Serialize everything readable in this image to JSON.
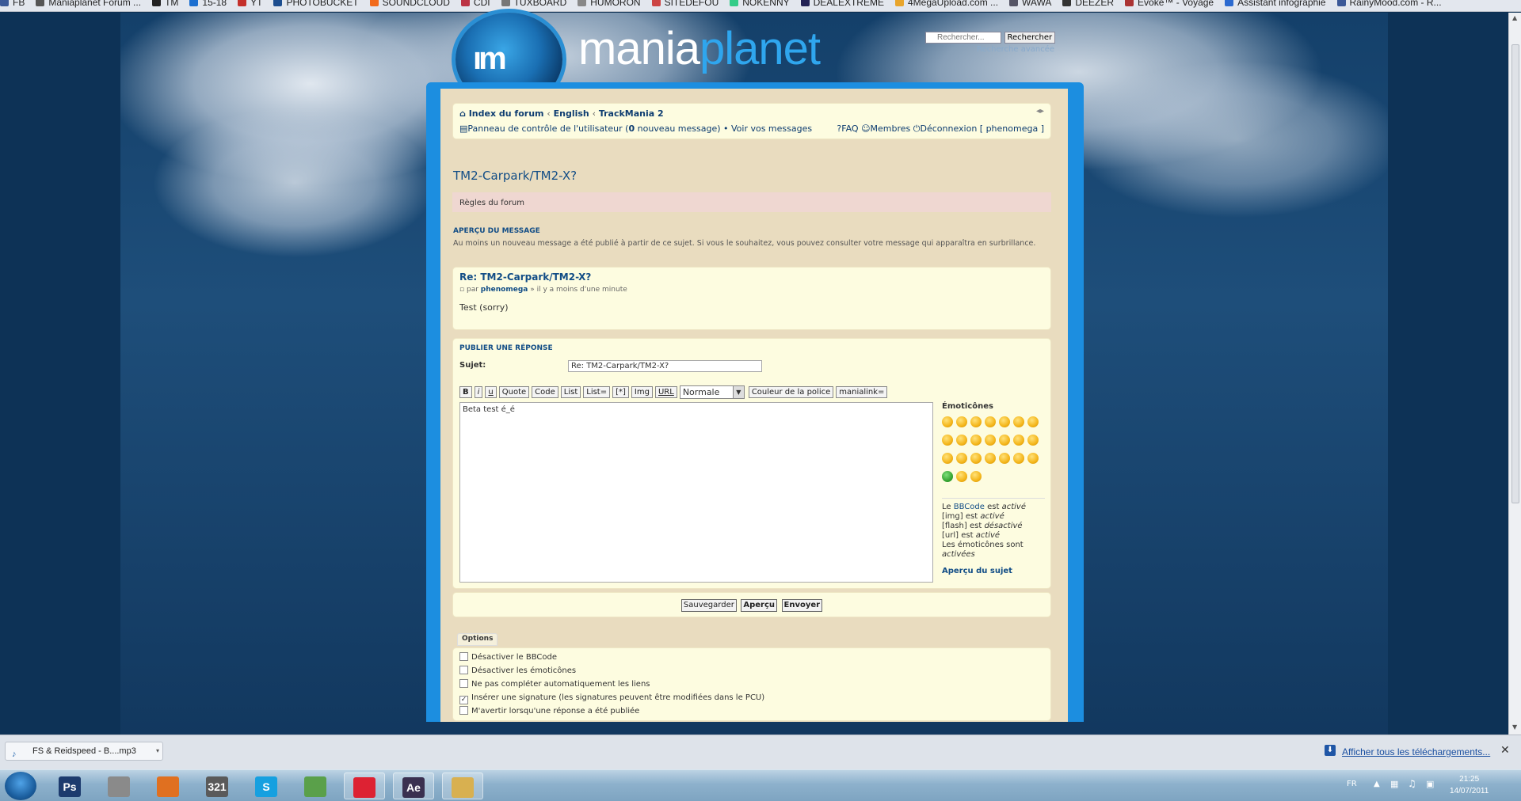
{
  "bookmarks": [
    "FB",
    "Maniaplanet Forum ...",
    "TM",
    "15-18",
    "YT",
    "PHOTOBUCKET",
    "SOUNDCLOUD",
    "CDI",
    "TUXBOARD",
    "HUMORON",
    "SITEDEFOU",
    "NOKENNY",
    "DEALEXTREME",
    "4MegaUpload.com ...",
    "WAWA",
    "DEEZER",
    "Evoke™ - Voyage",
    "Assistant infographie",
    "RainyMood.com - R..."
  ],
  "header": {
    "brand_a": "mania",
    "brand_b": "planet",
    "logo_glyph": "ım",
    "search_placeholder": "Rechercher...",
    "search_btn": "Rechercher",
    "advanced": "Recherche avancée"
  },
  "nav": {
    "crumb": [
      "Index du forum",
      "English",
      "TrackMania 2"
    ],
    "sep": "‹",
    "ucp_a": "Panneau de contrôle de l'utilisateur (",
    "ucp_count": "0",
    "ucp_b": " nouveau message) • Voir vos messages",
    "faq": "FAQ",
    "members": "Membres",
    "logout": "Déconnexion [ phenomega ]"
  },
  "topic_title": "TM2-Carpark/TM2-X?",
  "rules": "Règles du forum",
  "preview": {
    "heading": "APERÇU DU MESSAGE",
    "notice": "Au moins un nouveau message a été publié à partir de ce sujet. Si vous le souhaitez, vous pouvez consulter votre message qui apparaîtra en surbrillance.",
    "post_title": "Re: TM2-Carpark/TM2-X?",
    "by_a": "par",
    "author": "phenomega",
    "by_b": "» il y a moins d'une minute",
    "body": "Test (sorry)"
  },
  "reply": {
    "heading": "PUBLIER UNE RÉPONSE",
    "subject_label": "Sujet:",
    "subject_value": "Re: TM2-Carpark/TM2-X?",
    "toolbar": [
      "B",
      "i",
      "u",
      "Quote",
      "Code",
      "List",
      "List=",
      "[*]",
      "Img",
      "URL"
    ],
    "size": "Normale",
    "color_btn": "Couleur de la police",
    "mania_btn": "manialink=",
    "message": "Beta test é_é",
    "emo_heading": "Émoticônes",
    "bb": [
      "Le",
      "BBCode",
      "est",
      "activé"
    ],
    "img_s": "[img] est",
    "img_v": "activé",
    "flash_s": "[flash] est",
    "flash_v": "désactivé",
    "url_s": "[url] est",
    "url_v": "activé",
    "emo_s": "Les émoticônes sont",
    "emo_v": "activées",
    "topic_preview": "Aperçu du sujet"
  },
  "submit": {
    "save": "Sauvegarder",
    "preview": "Aperçu",
    "send": "Envoyer"
  },
  "options": {
    "tab": "Options",
    "items": [
      {
        "label": "Désactiver le BBCode",
        "checked": false
      },
      {
        "label": "Désactiver les émoticônes",
        "checked": false
      },
      {
        "label": "Ne pas compléter automatiquement les liens",
        "checked": false
      },
      {
        "label": "Insérer une signature (les signatures peuvent être modifiées dans le PCU)",
        "checked": true
      },
      {
        "label": "M'avertir lorsqu'une réponse a été publiée",
        "checked": false
      }
    ]
  },
  "downloads": {
    "file": "FS & Reidspeed - B....mp3",
    "all": "Afficher tous les téléchargements..."
  },
  "taskbar": {
    "lang": "FR",
    "time": "21:25",
    "date": "14/07/2011",
    "apps": [
      "Ps",
      "",
      "",
      "321",
      "S",
      "",
      "",
      "Ae",
      ""
    ]
  }
}
